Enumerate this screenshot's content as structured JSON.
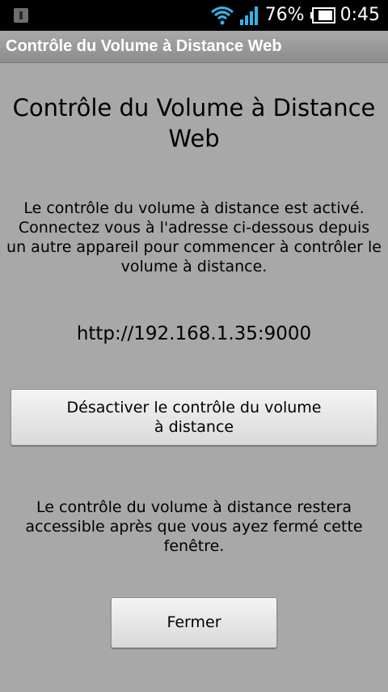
{
  "status_bar": {
    "battery_percent": "76%",
    "time": "0:45",
    "icons": [
      "notification-icon",
      "wifi-icon",
      "signal-icon",
      "battery-icon"
    ]
  },
  "title_bar": {
    "title": "Contrôle du Volume à Distance Web"
  },
  "main": {
    "heading_line1": "Contrôle du Volume à Distance",
    "heading_line2": "Web",
    "info_line1": "Le contrôle du volume à distance est activé.",
    "info_line2": "Connectez vous à l'adresse ci-dessous depuis",
    "info_line3": "un autre appareil pour commencer à contrôler le",
    "info_line4": "volume à distance.",
    "url": "http://192.168.1.35:9000",
    "disable_button_line1": "Désactiver le contrôle du volume",
    "disable_button_line2": "à distance",
    "note_line1": "Le contrôle du volume à distance restera",
    "note_line2": "accessible après que vous ayez fermé cette",
    "note_line3": "fenêtre.",
    "close_button": "Fermer"
  },
  "colors": {
    "background": "#a8a8a8",
    "status_bar": "#000000",
    "accent_blue": "#33b5e5"
  }
}
